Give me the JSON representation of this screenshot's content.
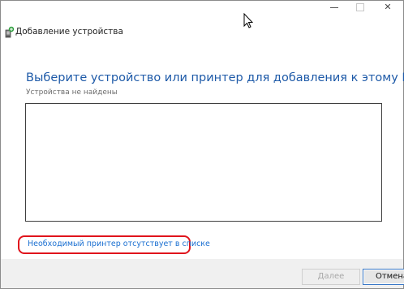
{
  "window": {
    "title": "Добавление устройства",
    "icon": "add-device-icon",
    "controls": {
      "minimize_icon": "minimize-icon",
      "maximize_icon": "maximize-icon",
      "close_label": "✕"
    }
  },
  "main": {
    "heading": "Выберите устройство или принтер для добавления к этому ПК",
    "status": "Устройства не найдены",
    "missing_printer_link": "Необходимый принтер отсутствует в списке"
  },
  "footer": {
    "next_label": "Далее",
    "cancel_label": "Отмена"
  },
  "colors": {
    "heading": "#1e5aa8",
    "link": "#1a6fd1",
    "highlight": "#e0141c",
    "footer_bg": "#f0f0f0"
  }
}
